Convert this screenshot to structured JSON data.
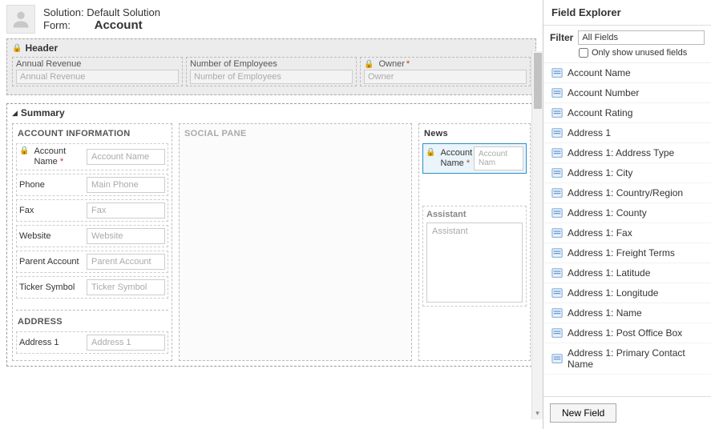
{
  "header": {
    "solution_label": "Solution:",
    "solution_name": "Default Solution",
    "form_label": "Form:",
    "form_name": "Account"
  },
  "sections": {
    "header": {
      "title": "Header",
      "fields": [
        {
          "label": "Annual Revenue",
          "placeholder": "Annual Revenue",
          "locked": false,
          "required": false
        },
        {
          "label": "Number of Employees",
          "placeholder": "Number of Employees",
          "locked": false,
          "required": false
        },
        {
          "label": "Owner",
          "placeholder": "Owner",
          "locked": true,
          "required": true
        }
      ]
    },
    "summary": {
      "title": "Summary",
      "account_info": {
        "title": "ACCOUNT INFORMATION",
        "fields": [
          {
            "label": "Account Name",
            "placeholder": "Account Name",
            "locked": true,
            "required": true
          },
          {
            "label": "Phone",
            "placeholder": "Main Phone"
          },
          {
            "label": "Fax",
            "placeholder": "Fax"
          },
          {
            "label": "Website",
            "placeholder": "Website"
          },
          {
            "label": "Parent Account",
            "placeholder": "Parent Account"
          },
          {
            "label": "Ticker Symbol",
            "placeholder": "Ticker Symbol"
          }
        ]
      },
      "social_pane": {
        "title": "SOCIAL PANE"
      },
      "news": {
        "title": "News",
        "field": {
          "label": "Account Name",
          "placeholder": "Account Nam",
          "locked": true,
          "required": true
        }
      },
      "assistant": {
        "title": "Assistant",
        "placeholder": "Assistant"
      },
      "address": {
        "title": "ADDRESS",
        "field": {
          "label": "Address 1",
          "placeholder": "Address 1"
        }
      }
    }
  },
  "explorer": {
    "title": "Field Explorer",
    "filter_label": "Filter",
    "filter_value": "All Fields",
    "unused_label": "Only show unused fields",
    "items": [
      "Account Name",
      "Account Number",
      "Account Rating",
      "Address 1",
      "Address 1: Address Type",
      "Address 1: City",
      "Address 1: Country/Region",
      "Address 1: County",
      "Address 1: Fax",
      "Address 1: Freight Terms",
      "Address 1: Latitude",
      "Address 1: Longitude",
      "Address 1: Name",
      "Address 1: Post Office Box",
      "Address 1: Primary Contact Name"
    ],
    "new_field": "New Field"
  }
}
